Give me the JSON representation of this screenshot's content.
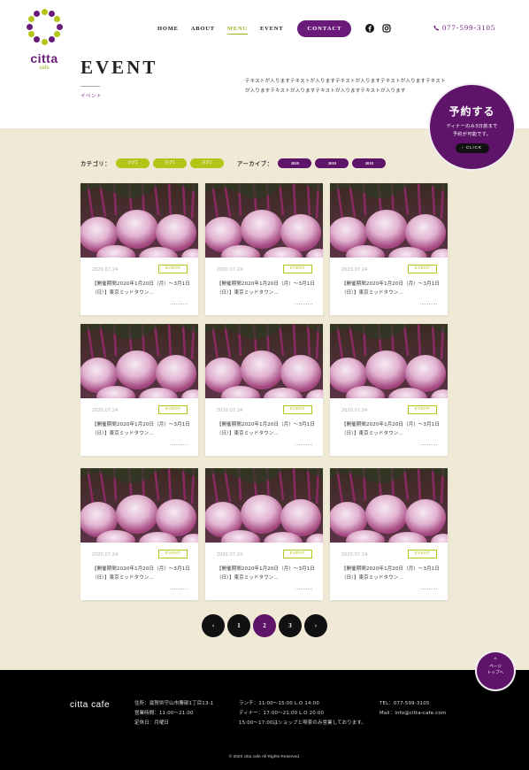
{
  "logo": {
    "name": "citta",
    "sub": "cafe"
  },
  "nav": {
    "items": [
      {
        "label": "HOME"
      },
      {
        "label": "ABOUT"
      },
      {
        "label": "MENU"
      },
      {
        "label": "EVENT"
      }
    ],
    "active_index": 2,
    "contact_label": "CONTACT",
    "social": [
      "facebook-icon",
      "instagram-icon"
    ],
    "tel": "077-599-3105"
  },
  "page": {
    "title": "EVENT",
    "subtitle": "イベント",
    "intro": "テキストが入りますテキストが入りますテキストが入りますテキストが入りますテキストが入りますテキストが入りますテキストが入りますテキストが入ります"
  },
  "reserve": {
    "title": "予約する",
    "note_line1": "ディナーのみ3日前まで",
    "note_line2": "予約が可能です。",
    "click": "CLICK"
  },
  "filters": {
    "category_label": "カテゴリ：",
    "tags": [
      "タグ1",
      "タグ1",
      "タグ1"
    ],
    "archive_label": "アーカイブ：",
    "archives": [
      "2020",
      "2019",
      "2018"
    ]
  },
  "cards": [
    {
      "date": "2020.07.24",
      "category": "EVENT",
      "title": "【開催期間2020年1月20日（月）〜3月1日（日）】東京ミッドタウン…"
    },
    {
      "date": "2020.07.24",
      "category": "EVENT",
      "title": "【開催期間2020年1月20日（月）〜3月1日（日）】東京ミッドタウン…"
    },
    {
      "date": "2020.07.24",
      "category": "EVENT",
      "title": "【開催期間2020年1月20日（月）〜3月1日（日）】東京ミッドタウン…"
    },
    {
      "date": "2020.07.24",
      "category": "EVENT",
      "title": "【開催期間2020年1月20日（月）〜3月1日（日）】東京ミッドタウン…"
    },
    {
      "date": "2020.07.24",
      "category": "EVENT",
      "title": "【開催期間2020年1月20日（月）〜3月1日（日）】東京ミッドタウン…"
    },
    {
      "date": "2020.07.24",
      "category": "EVENT",
      "title": "【開催期間2020年1月20日（月）〜3月1日（日）】東京ミッドタウン…"
    },
    {
      "date": "2020.07.24",
      "category": "EVENT",
      "title": "【開催期間2020年1月20日（月）〜3月1日（日）】東京ミッドタウン…"
    },
    {
      "date": "2020.07.24",
      "category": "EVENT",
      "title": "【開催期間2020年1月20日（月）〜3月1日（日）】東京ミッドタウン…"
    },
    {
      "date": "2020.07.24",
      "category": "EVENT",
      "title": "【開催期間2020年1月20日（月）〜3月1日（日）】東京ミッドタウン…"
    }
  ],
  "pagination": {
    "prev": "‹",
    "pages": [
      "1",
      "2",
      "3"
    ],
    "current": "2",
    "next": "›"
  },
  "pagetop": {
    "arrow": "⌃",
    "line1": "ページ",
    "line2": "トップへ"
  },
  "footer": {
    "brand": "citta cafe",
    "address": "住所：滋賀県守山市勝部1丁目13-1",
    "hours": "営業時間：11:00〜21:00",
    "closed": "定休日：月曜日",
    "lunch": "ランチ：11:00〜15:00 L.O 14:00",
    "dinner": "ディナー：17:00〜21:00 L.O 20:00",
    "shop_note": "15:00〜17:00はショップと喫茶のみ営業しております。",
    "tel": "TEL：077-599-3105",
    "mail": "Mail：info@citta-cafe.com",
    "copyright": "© 2020 citta cafe All Rights Reserved."
  },
  "colors": {
    "accent": "#5e1468",
    "green": "#b5c418",
    "bg": "#efe9d6"
  }
}
